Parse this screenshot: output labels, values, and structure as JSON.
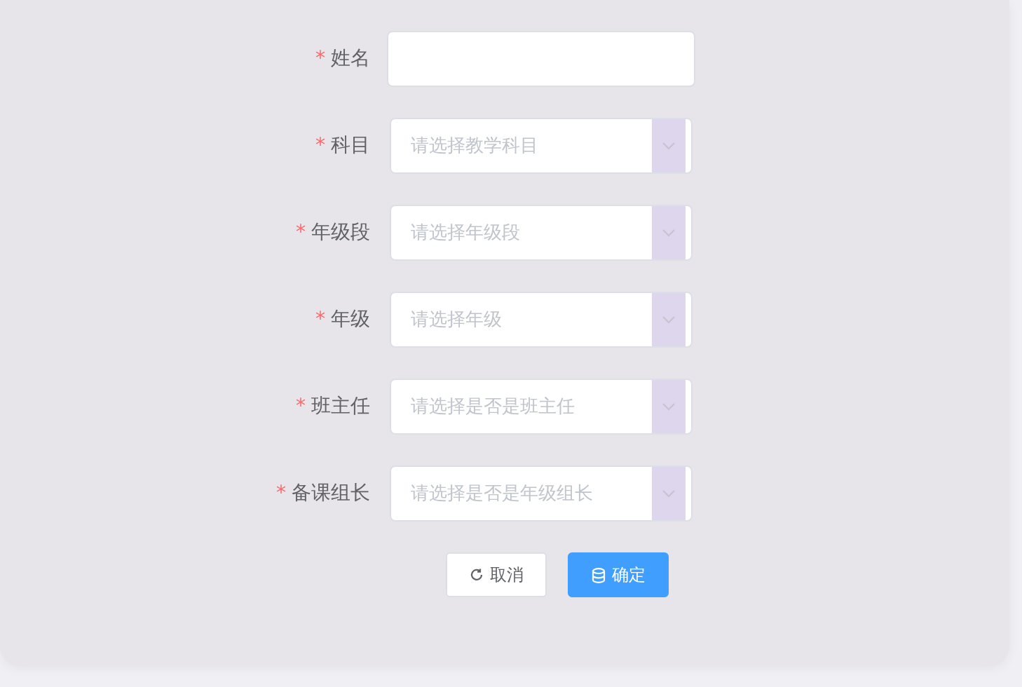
{
  "form": {
    "fields": [
      {
        "mark": "*",
        "label": "姓名",
        "kind": "input"
      },
      {
        "mark": "*",
        "label": "科目",
        "kind": "select",
        "placeholder": "请选择教学科目"
      },
      {
        "mark": "*",
        "label": "年级段",
        "kind": "select",
        "placeholder": "请选择年级段"
      },
      {
        "mark": "*",
        "label": "年级",
        "kind": "select",
        "placeholder": "请选择年级"
      },
      {
        "mark": "*",
        "label": "班主任",
        "kind": "select",
        "placeholder": "请选择是否是班主任"
      },
      {
        "mark": "*",
        "label": "备课组长",
        "kind": "select",
        "placeholder": "请选择是否是年级组长"
      }
    ],
    "buttons": [
      {
        "label": "取消",
        "kind": "default"
      },
      {
        "label": "确定",
        "kind": "primary"
      }
    ]
  }
}
